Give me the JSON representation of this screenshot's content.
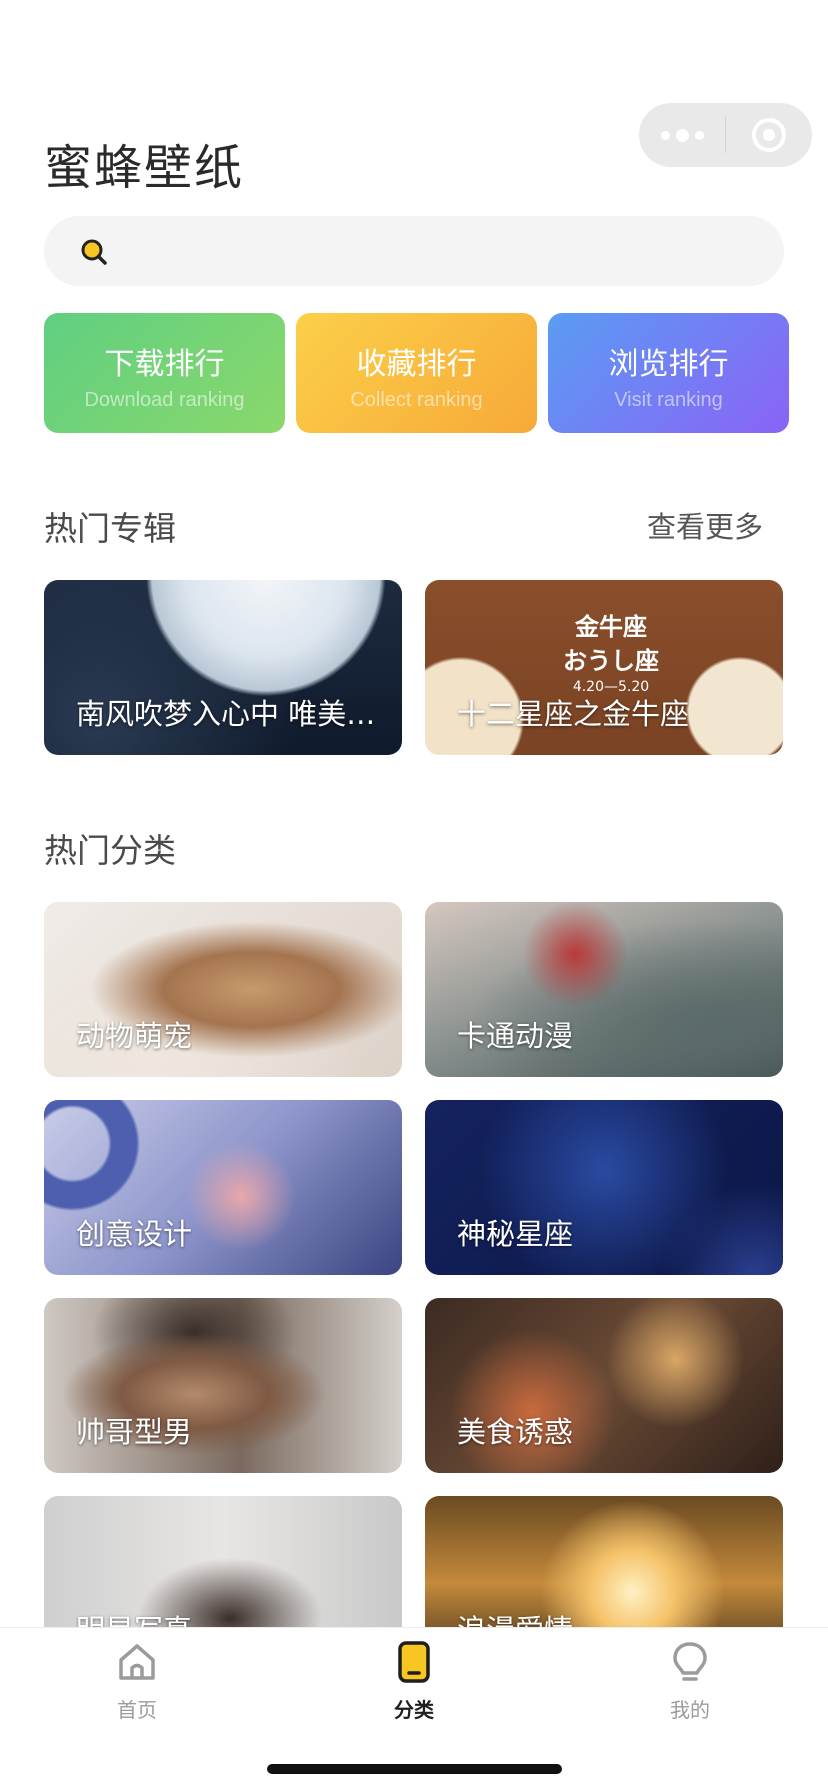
{
  "app": {
    "title": "蜜蜂壁纸"
  },
  "search": {
    "placeholder": "",
    "icon": "search-icon",
    "icon_color": "#f7c623"
  },
  "ranking_buttons": [
    {
      "title": "下载排行",
      "subtitle": "Download ranking",
      "gradient": [
        "#5fcf82",
        "#8ad86a"
      ]
    },
    {
      "title": "收藏排行",
      "subtitle": "Collect ranking",
      "gradient": [
        "#fbd049",
        "#f7a938"
      ]
    },
    {
      "title": "浏览排行",
      "subtitle": "Visit ranking",
      "gradient": [
        "#5a9cf3",
        "#8a63f6"
      ]
    }
  ],
  "hot_albums": {
    "title": "热门专辑",
    "more_label": "查看更多",
    "items": [
      {
        "label": "南风吹梦入心中 唯美…"
      },
      {
        "label": "十二星座之金牛座",
        "image_text": [
          "金牛座",
          "おうし座",
          "4.20—5.20"
        ]
      }
    ]
  },
  "hot_categories": {
    "title": "热门分类",
    "items": [
      {
        "label": "动物萌宠"
      },
      {
        "label": "卡通动漫"
      },
      {
        "label": "创意设计"
      },
      {
        "label": "神秘星座"
      },
      {
        "label": "帅哥型男"
      },
      {
        "label": "美食诱惑"
      },
      {
        "label": "明星写真"
      },
      {
        "label": "浪漫爱情"
      }
    ]
  },
  "tabbar": {
    "items": [
      {
        "label": "首页",
        "icon": "home-icon",
        "active": false
      },
      {
        "label": "分类",
        "icon": "category-icon",
        "active": true
      },
      {
        "label": "我的",
        "icon": "bulb-icon",
        "active": false
      }
    ],
    "active_color": "#f7c623"
  }
}
